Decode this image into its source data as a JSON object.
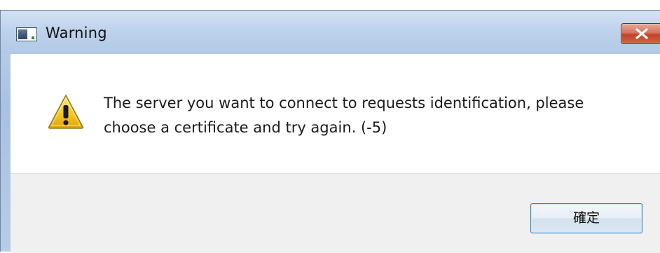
{
  "window": {
    "title": "Warning",
    "app_icon": "application-window-icon",
    "close_icon": "close-icon"
  },
  "dialog": {
    "icon": "warning-triangle-icon",
    "message_line1": "The server you want to connect to requests identification, please",
    "message_line2": "choose a certificate and try again. (-5)"
  },
  "buttons": {
    "ok_label": "確定"
  },
  "colors": {
    "close_button": "#c94a30",
    "warning_yellow": "#f6c81c",
    "button_bar": "#f0f0f0",
    "ok_border": "#3c7fb1"
  }
}
